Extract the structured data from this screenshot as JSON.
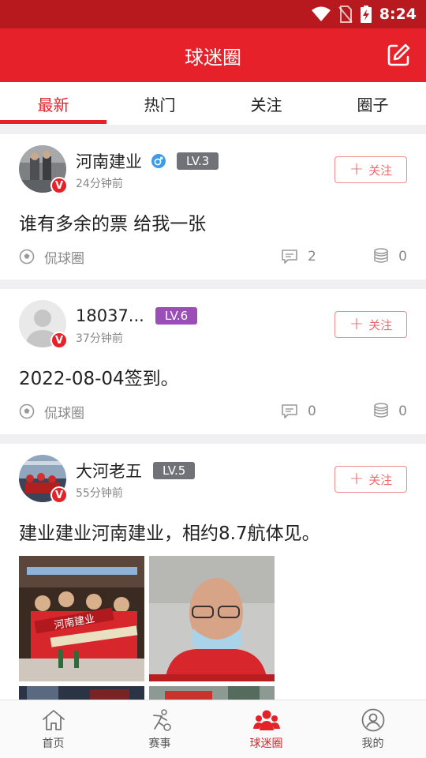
{
  "status_bar": {
    "time": "8:24"
  },
  "header": {
    "title": "球迷圈",
    "edit_icon": "edit-icon"
  },
  "tabs": [
    {
      "label": "最新",
      "active": true
    },
    {
      "label": "热门",
      "active": false
    },
    {
      "label": "关注",
      "active": false
    },
    {
      "label": "圈子",
      "active": false
    }
  ],
  "posts": [
    {
      "name": "河南建业",
      "level": "LV.3",
      "level_color": "#6f7378",
      "time": "24分钟前",
      "follow_label": "关注",
      "content": "谁有多余的票 给我一张",
      "circle": "侃球圈",
      "comments": "2",
      "coins": "0",
      "gender": "male"
    },
    {
      "name": "18037...",
      "level": "LV.6",
      "level_color": "#9b4fb6",
      "time": "37分钟前",
      "follow_label": "关注",
      "content": "2022-08-04签到。",
      "circle": "侃球圈",
      "comments": "0",
      "coins": "0"
    },
    {
      "name": "大河老五",
      "level": "LV.5",
      "level_color": "#6f7378",
      "time": "55分钟前",
      "follow_label": "关注",
      "content": "建业建业河南建业，相约8.7航体见。",
      "pic_text": "河南建业"
    }
  ],
  "bottom_nav": [
    {
      "label": "首页",
      "icon": "home-icon",
      "active": false
    },
    {
      "label": "赛事",
      "icon": "match-icon",
      "active": false
    },
    {
      "label": "球迷圈",
      "icon": "fans-circle-icon",
      "active": true
    },
    {
      "label": "我的",
      "icon": "profile-icon",
      "active": false
    }
  ],
  "colors": {
    "brand_red": "#e62129",
    "status_bar": "#b8191e"
  }
}
